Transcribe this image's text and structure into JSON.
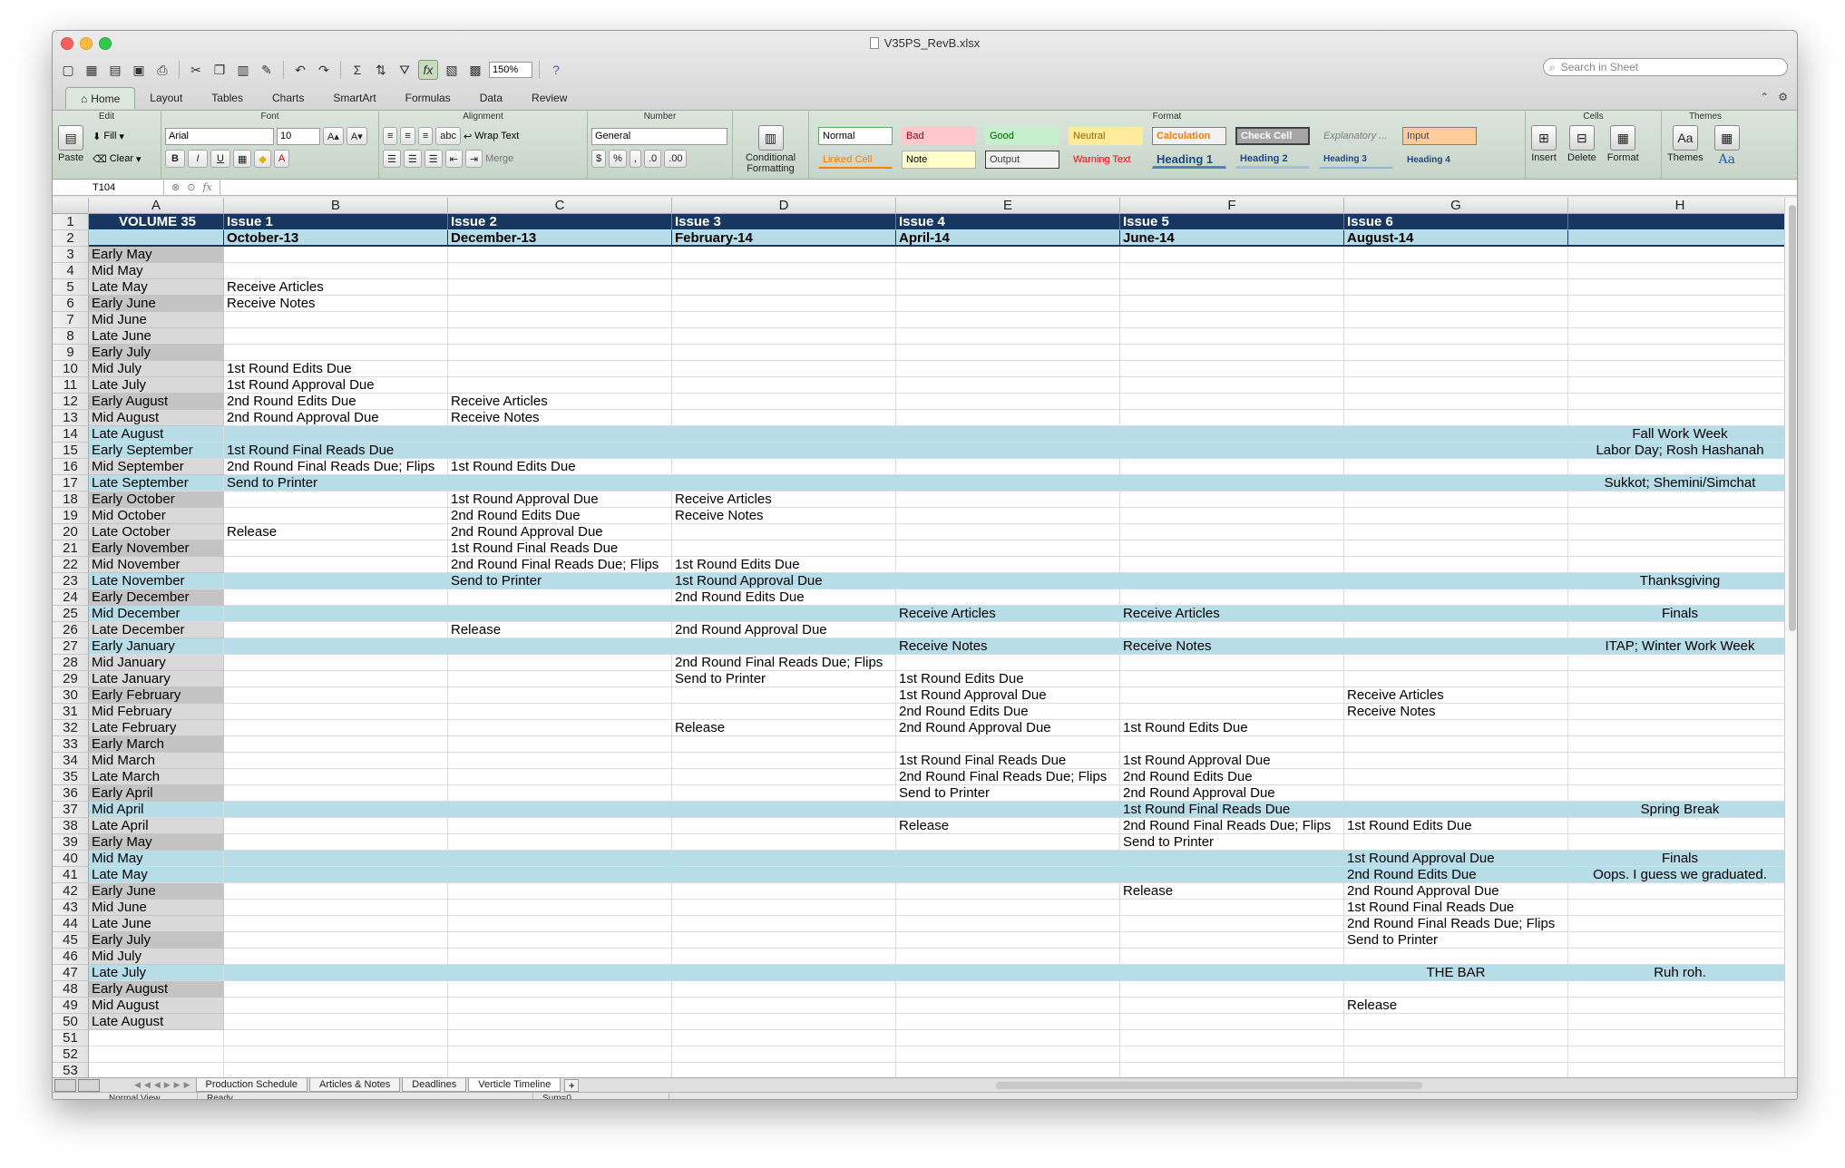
{
  "window": {
    "title": "V35PS_RevB.xlsx"
  },
  "toolbar": {
    "zoom": "150%",
    "search_placeholder": "Search in Sheet"
  },
  "ribbon_tabs": [
    "Home",
    "Layout",
    "Tables",
    "Charts",
    "SmartArt",
    "Formulas",
    "Data",
    "Review"
  ],
  "ribbon": {
    "groups": {
      "edit": "Edit",
      "font": "Font",
      "alignment": "Alignment",
      "number": "Number",
      "format": "Format",
      "cells": "Cells",
      "themes": "Themes"
    },
    "paste": "Paste",
    "fill": "Fill",
    "clear": "Clear",
    "font_name": "Arial",
    "font_size": "10",
    "bold": "B",
    "italic": "I",
    "underline": "U",
    "wrap_text": "Wrap Text",
    "merge": "Merge",
    "abc": "abc",
    "number_format": "General",
    "percent": "%",
    "comma": ",",
    "conditional_formatting_1": "Conditional",
    "conditional_formatting_2": "Formatting",
    "styles": [
      "Normal",
      "Bad",
      "Good",
      "Neutral",
      "Calculation",
      "Check Cell",
      "Explanatory ...",
      "Input",
      "Linked Cell",
      "Note",
      "Output",
      "Warning Text",
      "Heading 1",
      "Heading 2",
      "Heading 3",
      "Heading 4"
    ],
    "insert": "Insert",
    "delete": "Delete",
    "format_btn": "Format",
    "themes_btn": "Themes",
    "font_aa": "Aa"
  },
  "formula_bar": {
    "name_box": "T104",
    "fx": "fx"
  },
  "columns": [
    "A",
    "B",
    "C",
    "D",
    "E",
    "F",
    "G",
    "H"
  ],
  "rows": [
    {
      "n": "1",
      "A": "VOLUME 35",
      "B": "Issue 1",
      "C": "Issue 2",
      "D": "Issue 3",
      "E": "Issue 4",
      "F": "Issue 5",
      "G": "Issue 6",
      "H": ""
    },
    {
      "n": "2",
      "A": "",
      "B": "October-13",
      "C": "December-13",
      "D": "February-14",
      "E": "April-14",
      "F": "June-14",
      "G": "August-14",
      "H": ""
    },
    {
      "n": "3",
      "A": "Early May",
      "B": "",
      "C": "",
      "D": "",
      "E": "",
      "F": "",
      "G": "",
      "H": ""
    },
    {
      "n": "4",
      "A": "Mid May",
      "B": "",
      "C": "",
      "D": "",
      "E": "",
      "F": "",
      "G": "",
      "H": ""
    },
    {
      "n": "5",
      "A": "Late May",
      "B": "Receive Articles",
      "C": "",
      "D": "",
      "E": "",
      "F": "",
      "G": "",
      "H": ""
    },
    {
      "n": "6",
      "A": "Early June",
      "B": "Receive Notes",
      "C": "",
      "D": "",
      "E": "",
      "F": "",
      "G": "",
      "H": ""
    },
    {
      "n": "7",
      "A": "Mid June",
      "B": "",
      "C": "",
      "D": "",
      "E": "",
      "F": "",
      "G": "",
      "H": ""
    },
    {
      "n": "8",
      "A": "Late June",
      "B": "",
      "C": "",
      "D": "",
      "E": "",
      "F": "",
      "G": "",
      "H": ""
    },
    {
      "n": "9",
      "A": "Early July",
      "B": "",
      "C": "",
      "D": "",
      "E": "",
      "F": "",
      "G": "",
      "H": ""
    },
    {
      "n": "10",
      "A": "Mid July",
      "B": "1st Round Edits Due",
      "C": "",
      "D": "",
      "E": "",
      "F": "",
      "G": "",
      "H": ""
    },
    {
      "n": "11",
      "A": "Late July",
      "B": "1st Round Approval Due",
      "C": "",
      "D": "",
      "E": "",
      "F": "",
      "G": "",
      "H": ""
    },
    {
      "n": "12",
      "A": "Early August",
      "B": "2nd Round Edits Due",
      "C": "Receive Articles",
      "D": "",
      "E": "",
      "F": "",
      "G": "",
      "H": ""
    },
    {
      "n": "13",
      "A": "Mid August",
      "B": "2nd Round Approval Due",
      "C": "Receive Notes",
      "D": "",
      "E": "",
      "F": "",
      "G": "",
      "H": ""
    },
    {
      "n": "14",
      "A": "Late August",
      "B": "",
      "C": "",
      "D": "",
      "E": "",
      "F": "",
      "G": "",
      "H": "Fall Work Week",
      "hl": true
    },
    {
      "n": "15",
      "A": "Early September",
      "B": "1st Round Final Reads Due",
      "C": "",
      "D": "",
      "E": "",
      "F": "",
      "G": "",
      "H": "Labor Day; Rosh Hashanah",
      "hl": true
    },
    {
      "n": "16",
      "A": "Mid September",
      "B": "2nd Round Final Reads Due; Flips",
      "C": "1st Round Edits Due",
      "D": "",
      "E": "",
      "F": "",
      "G": "",
      "H": ""
    },
    {
      "n": "17",
      "A": "Late September",
      "B": "Send to Printer",
      "C": "",
      "D": "",
      "E": "",
      "F": "",
      "G": "",
      "H": "Sukkot; Shemini/Simchat",
      "hl": true
    },
    {
      "n": "18",
      "A": "Early October",
      "B": "",
      "C": "1st Round Approval Due",
      "D": "Receive Articles",
      "E": "",
      "F": "",
      "G": "",
      "H": ""
    },
    {
      "n": "19",
      "A": "Mid October",
      "B": "",
      "C": "2nd Round Edits Due",
      "D": "Receive Notes",
      "E": "",
      "F": "",
      "G": "",
      "H": ""
    },
    {
      "n": "20",
      "A": "Late October",
      "B": "Release",
      "C": "2nd Round Approval Due",
      "D": "",
      "E": "",
      "F": "",
      "G": "",
      "H": ""
    },
    {
      "n": "21",
      "A": "Early November",
      "B": "",
      "C": "1st Round Final Reads Due",
      "D": "",
      "E": "",
      "F": "",
      "G": "",
      "H": ""
    },
    {
      "n": "22",
      "A": "Mid November",
      "B": "",
      "C": "2nd Round Final Reads Due; Flips",
      "D": "1st Round Edits Due",
      "E": "",
      "F": "",
      "G": "",
      "H": ""
    },
    {
      "n": "23",
      "A": "Late November",
      "B": "",
      "C": "Send to Printer",
      "D": "1st Round Approval Due",
      "E": "",
      "F": "",
      "G": "",
      "H": "Thanksgiving",
      "hl": true
    },
    {
      "n": "24",
      "A": "Early December",
      "B": "",
      "C": "",
      "D": "2nd Round Edits Due",
      "E": "",
      "F": "",
      "G": "",
      "H": ""
    },
    {
      "n": "25",
      "A": "Mid December",
      "B": "",
      "C": "",
      "D": "",
      "E": "Receive Articles",
      "F": "Receive Articles",
      "G": "",
      "H": "Finals",
      "hl": true
    },
    {
      "n": "26",
      "A": "Late December",
      "B": "",
      "C": "Release",
      "D": "2nd Round Approval Due",
      "E": "",
      "F": "",
      "G": "",
      "H": ""
    },
    {
      "n": "27",
      "A": "Early January",
      "B": "",
      "C": "",
      "D": "",
      "E": "Receive Notes",
      "F": "Receive Notes",
      "G": "",
      "H": "ITAP; Winter Work Week",
      "hl": true
    },
    {
      "n": "28",
      "A": "Mid January",
      "B": "",
      "C": "",
      "D": "2nd Round Final Reads Due; Flips",
      "E": "",
      "F": "",
      "G": "",
      "H": ""
    },
    {
      "n": "29",
      "A": "Late January",
      "B": "",
      "C": "",
      "D": "Send to Printer",
      "E": "1st Round Edits Due",
      "F": "",
      "G": "",
      "H": ""
    },
    {
      "n": "30",
      "A": "Early February",
      "B": "",
      "C": "",
      "D": "",
      "E": "1st Round Approval Due",
      "F": "",
      "G": "Receive Articles",
      "H": ""
    },
    {
      "n": "31",
      "A": "Mid February",
      "B": "",
      "C": "",
      "D": "",
      "E": "2nd Round Edits Due",
      "F": "",
      "G": "Receive Notes",
      "H": ""
    },
    {
      "n": "32",
      "A": "Late February",
      "B": "",
      "C": "",
      "D": "Release",
      "E": "2nd Round Approval Due",
      "F": "1st Round Edits Due",
      "G": "",
      "H": ""
    },
    {
      "n": "33",
      "A": "Early March",
      "B": "",
      "C": "",
      "D": "",
      "E": "",
      "F": "",
      "G": "",
      "H": ""
    },
    {
      "n": "34",
      "A": "Mid March",
      "B": "",
      "C": "",
      "D": "",
      "E": "1st Round Final Reads Due",
      "F": "1st Round Approval Due",
      "G": "",
      "H": ""
    },
    {
      "n": "35",
      "A": "Late March",
      "B": "",
      "C": "",
      "D": "",
      "E": "2nd Round Final Reads Due; Flips",
      "F": "2nd Round Edits Due",
      "G": "",
      "H": ""
    },
    {
      "n": "36",
      "A": "Early April",
      "B": "",
      "C": "",
      "D": "",
      "E": "Send to Printer",
      "F": "2nd Round Approval Due",
      "G": "",
      "H": ""
    },
    {
      "n": "37",
      "A": "Mid April",
      "B": "",
      "C": "",
      "D": "",
      "E": "",
      "F": "1st Round Final Reads Due",
      "G": "",
      "H": "Spring Break",
      "hl": true
    },
    {
      "n": "38",
      "A": "Late April",
      "B": "",
      "C": "",
      "D": "",
      "E": "Release",
      "F": "2nd Round Final Reads Due; Flips",
      "G": "1st Round Edits Due",
      "H": ""
    },
    {
      "n": "39",
      "A": "Early May",
      "B": "",
      "C": "",
      "D": "",
      "E": "",
      "F": "Send to Printer",
      "G": "",
      "H": ""
    },
    {
      "n": "40",
      "A": "Mid May",
      "B": "",
      "C": "",
      "D": "",
      "E": "",
      "F": "",
      "G": "1st Round Approval Due",
      "H": "Finals",
      "hl": true
    },
    {
      "n": "41",
      "A": "Late May",
      "B": "",
      "C": "",
      "D": "",
      "E": "",
      "F": "",
      "G": "2nd Round Edits Due",
      "H": "Oops. I guess we graduated.",
      "hl": true
    },
    {
      "n": "42",
      "A": "Early June",
      "B": "",
      "C": "",
      "D": "",
      "E": "",
      "F": "Release",
      "G": "2nd Round Approval Due",
      "H": ""
    },
    {
      "n": "43",
      "A": "Mid June",
      "B": "",
      "C": "",
      "D": "",
      "E": "",
      "F": "",
      "G": "1st Round Final Reads Due",
      "H": ""
    },
    {
      "n": "44",
      "A": "Late June",
      "B": "",
      "C": "",
      "D": "",
      "E": "",
      "F": "",
      "G": "2nd Round Final Reads Due; Flips",
      "H": ""
    },
    {
      "n": "45",
      "A": "Early July",
      "B": "",
      "C": "",
      "D": "",
      "E": "",
      "F": "",
      "G": "Send to Printer",
      "H": ""
    },
    {
      "n": "46",
      "A": "Mid July",
      "B": "",
      "C": "",
      "D": "",
      "E": "",
      "F": "",
      "G": "",
      "H": ""
    },
    {
      "n": "47",
      "A": "Late July",
      "B": "",
      "C": "",
      "D": "",
      "E": "",
      "F": "",
      "G": "THE BAR",
      "H": "Ruh roh.",
      "hl": true,
      "gctr": true
    },
    {
      "n": "48",
      "A": "Early August",
      "B": "",
      "C": "",
      "D": "",
      "E": "",
      "F": "",
      "G": "",
      "H": ""
    },
    {
      "n": "49",
      "A": "Mid August",
      "B": "",
      "C": "",
      "D": "",
      "E": "",
      "F": "",
      "G": "Release",
      "H": ""
    },
    {
      "n": "50",
      "A": "Late August",
      "B": "",
      "C": "",
      "D": "",
      "E": "",
      "F": "",
      "G": "",
      "H": ""
    },
    {
      "n": "51",
      "A": "",
      "B": "",
      "C": "",
      "D": "",
      "E": "",
      "F": "",
      "G": "",
      "H": ""
    },
    {
      "n": "52",
      "A": "",
      "B": "",
      "C": "",
      "D": "",
      "E": "",
      "F": "",
      "G": "",
      "H": ""
    },
    {
      "n": "53",
      "A": "",
      "B": "",
      "C": "",
      "D": "",
      "E": "",
      "F": "",
      "G": "",
      "H": ""
    }
  ],
  "sheet_tabs": [
    "Production Schedule",
    "Articles & Notes",
    "Deadlines",
    "Verticle Timeline"
  ],
  "active_sheet": "Verticle Timeline",
  "status": {
    "view": "Normal View",
    "state": "Ready",
    "sum": "Sum=0"
  },
  "colors": {
    "title_fill": "#17375e",
    "highlight_fill": "#b7dde8",
    "row_header_gray": "#d9d9d9"
  }
}
